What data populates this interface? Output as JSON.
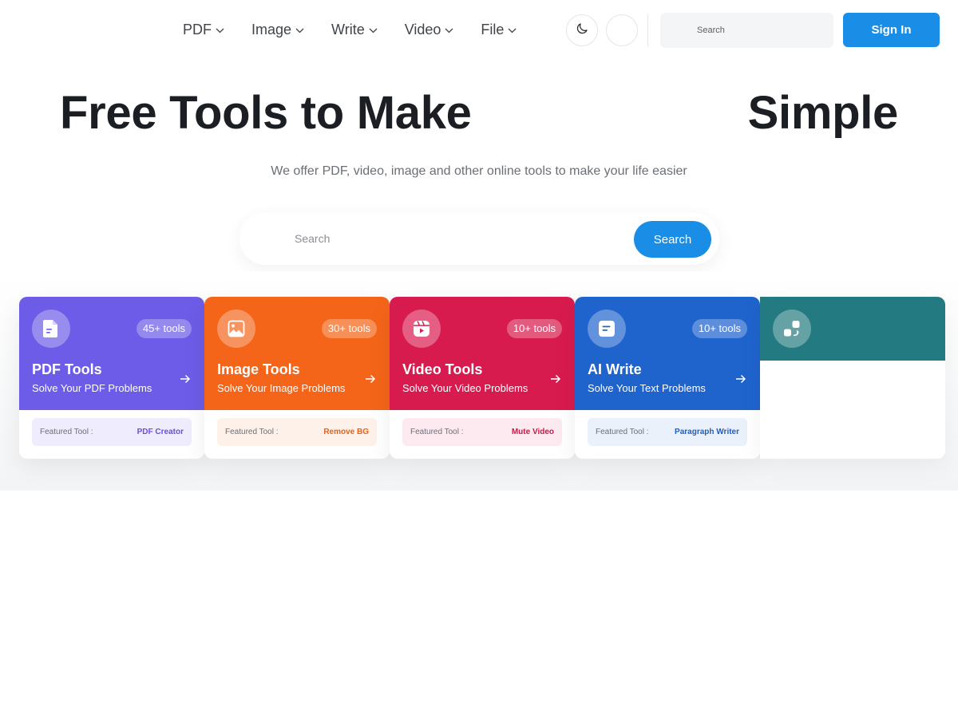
{
  "nav": {
    "items": [
      {
        "label": "PDF"
      },
      {
        "label": "Image"
      },
      {
        "label": "Write"
      },
      {
        "label": "Video"
      },
      {
        "label": "File"
      }
    ],
    "search_placeholder": "Search",
    "sign_in": "Sign In"
  },
  "hero": {
    "title_left": "Free Tools to Make",
    "title_right": "Simple",
    "subtitle": "We offer PDF, video, image and other online tools to make your life easier",
    "search_placeholder": "Search",
    "search_button": "Search"
  },
  "cards": [
    {
      "title": "PDF Tools",
      "desc": "Solve Your PDF Problems",
      "count": "45+ tools",
      "featured_label": "Featured Tool :",
      "featured_value": "PDF Creator",
      "color": "#6c5ce7",
      "accent": "#6c4fd8",
      "featured_bg": "#efecfd",
      "icon": "pdf-file-icon"
    },
    {
      "title": "Image Tools",
      "desc": "Solve Your Image Problems",
      "count": "30+ tools",
      "featured_label": "Featured Tool :",
      "featured_value": "Remove BG",
      "color": "#f46519",
      "accent": "#e3641c",
      "featured_bg": "#fdf1ea",
      "icon": "image-icon"
    },
    {
      "title": "Video Tools",
      "desc": "Solve Your Video Problems",
      "count": "10+ tools",
      "featured_label": "Featured Tool :",
      "featured_value": "Mute Video",
      "color": "#d81b4e",
      "accent": "#c8184a",
      "featured_bg": "#fdeaf0",
      "icon": "video-icon"
    },
    {
      "title": "AI Write",
      "desc": "Solve Your Text Problems",
      "count": "10+ tools",
      "featured_label": "Featured Tool :",
      "featured_value": "Paragraph Writer",
      "color": "#1f63cd",
      "accent": "#1f5fc4",
      "featured_bg": "#ebf1fb",
      "icon": "document-text-icon"
    },
    {
      "color": "#237a80",
      "icon": "shapes-icon"
    }
  ]
}
